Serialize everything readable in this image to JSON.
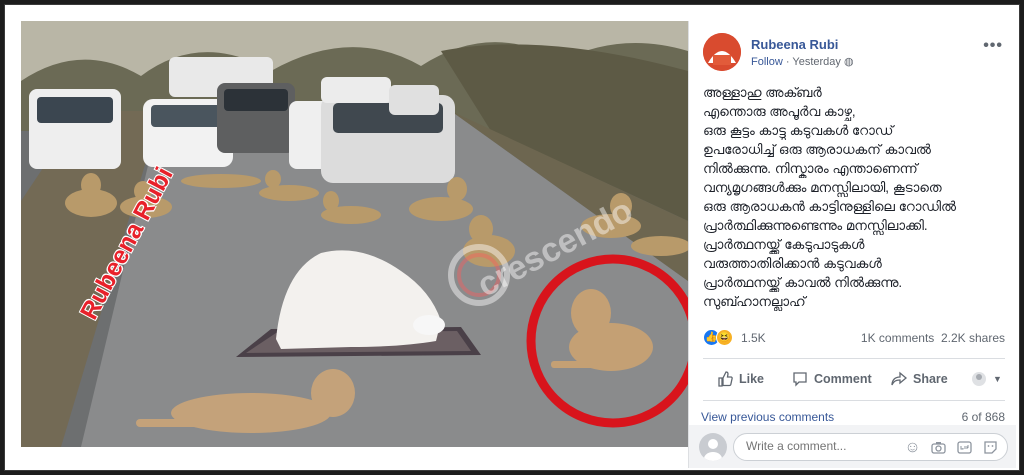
{
  "photo": {
    "watermark": "Rubeena Rubi",
    "stamp": "crescendo"
  },
  "post": {
    "author": "Rubeena Rubi",
    "follow": "Follow",
    "time": "Yesterday",
    "lines": [
      "അള്ളാഹു അക്ബർ",
      "എന്തൊരു അപൂർവ കാഴ്ച,",
      "ഒരു കൂട്ടം കാട്ടു കടുവകൾ റോഡ്",
      "ഉപരോധിച്ച് ഒരു ആരാധകന് കാവൽ",
      "നിൽക്കുന്നു. നിസ്കാരം എന്താണെന്ന്",
      "വന്യമൃഗങ്ങൾക്കും മനസ്സിലായി, കൂടാതെ",
      "ഒരു ആരാധകൻ കാട്ടിനുള്ളിലെ റോഡിൽ",
      "പ്രാർത്ഥിക്കുന്നുണ്ടെന്നും മനസ്സിലാക്കി.",
      "പ്രാർത്ഥനയ്ക്ക് കേടുപാടുകൾ",
      "വരുത്താതിരിക്കാൻ കടുവകൾ",
      "പ്രാർത്ഥനയ്ക്ക് കാവൽ നിൽക്കുന്നു.",
      "സുബ്ഹാനല്ലാഹ്"
    ]
  },
  "stats": {
    "reactions": "1.5K",
    "comments": "1K comments",
    "shares": "2.2K shares"
  },
  "actions": {
    "like": "Like",
    "comment": "Comment",
    "share": "Share"
  },
  "comments": {
    "view_previous": "View previous comments",
    "count": "6 of 868",
    "placeholder": "Write a comment..."
  },
  "colors": {
    "link": "#385898",
    "accent_red": "#e8212a"
  }
}
